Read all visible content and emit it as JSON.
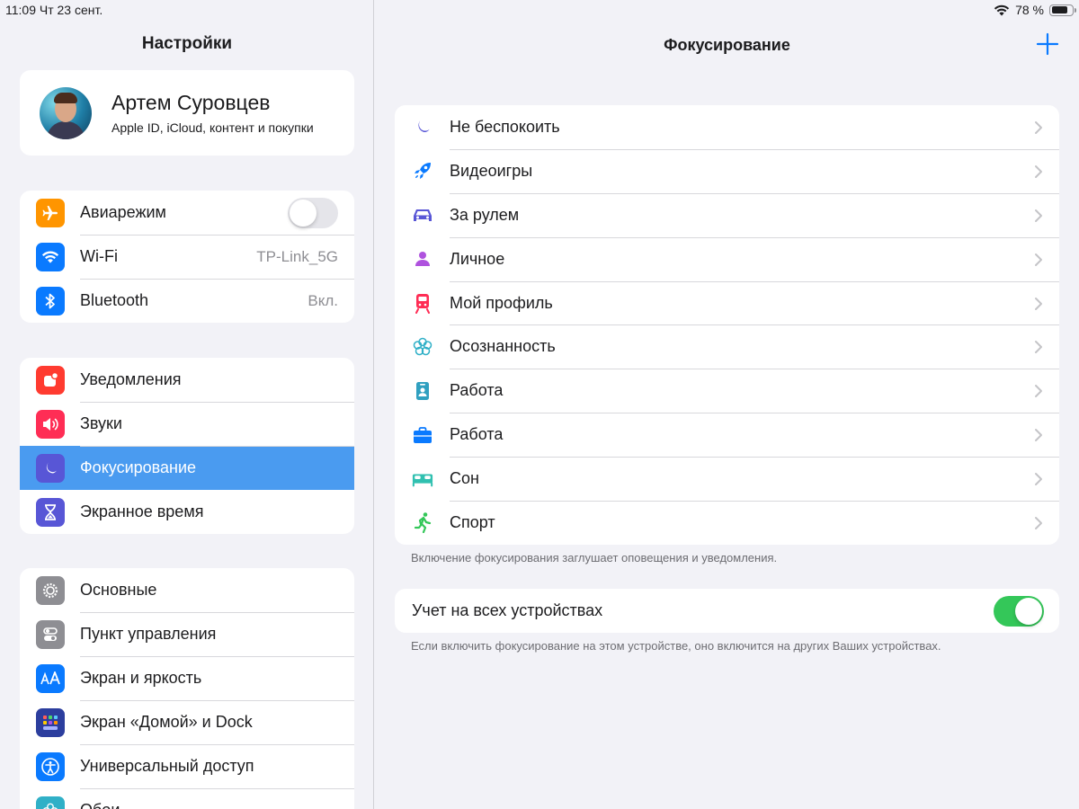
{
  "status": {
    "time": "11:09",
    "date": "Чт 23 сент.",
    "battery": "78 %",
    "battery_level": 0.78
  },
  "sidebar": {
    "title": "Настройки",
    "profile": {
      "name": "Артем Суровцев",
      "subtitle": "Apple ID, iCloud, контент и покупки"
    },
    "group1": [
      {
        "label": "Авиарежим",
        "icon": "airplane-icon",
        "color": "#ff9500",
        "toggle": false
      },
      {
        "label": "Wi-Fi",
        "icon": "wifi-icon",
        "color": "#0a7aff",
        "value": "TP-Link_5G"
      },
      {
        "label": "Bluetooth",
        "icon": "bluetooth-icon",
        "color": "#0a7aff",
        "value": "Вкл."
      }
    ],
    "group2": [
      {
        "label": "Уведомления",
        "icon": "notifications-icon",
        "color": "#ff3b30"
      },
      {
        "label": "Звуки",
        "icon": "speaker-icon",
        "color": "#ff2d55"
      },
      {
        "label": "Фокусирование",
        "icon": "moon-icon",
        "color": "#5856d6",
        "selected": true
      },
      {
        "label": "Экранное время",
        "icon": "hourglass-icon",
        "color": "#5856d6"
      }
    ],
    "group3": [
      {
        "label": "Основные",
        "icon": "gear-icon",
        "color": "#8e8e93"
      },
      {
        "label": "Пункт управления",
        "icon": "switches-icon",
        "color": "#8e8e93"
      },
      {
        "label": "Экран и яркость",
        "icon": "text-size-icon",
        "color": "#0a7aff"
      },
      {
        "label": "Экран «Домой» и Dock",
        "icon": "home-grid-icon",
        "color": "#2c3e9e"
      },
      {
        "label": "Универсальный доступ",
        "icon": "accessibility-icon",
        "color": "#0a7aff"
      },
      {
        "label": "Обои",
        "icon": "flower-icon",
        "color": "#30b0c7"
      }
    ]
  },
  "detail": {
    "title": "Фокусирование",
    "add_label": "+",
    "items": [
      {
        "label": "Не беспокоить",
        "icon": "moon-icon",
        "color": "#5856d6"
      },
      {
        "label": "Видеоигры",
        "icon": "rocket-icon",
        "color": "#0a7aff"
      },
      {
        "label": "За рулем",
        "icon": "car-icon",
        "color": "#5856d6"
      },
      {
        "label": "Личное",
        "icon": "person-icon",
        "color": "#af52de"
      },
      {
        "label": "Мой профиль",
        "icon": "train-icon",
        "color": "#ff2d55"
      },
      {
        "label": "Осознанность",
        "icon": "mindfulness-icon",
        "color": "#30b0c7"
      },
      {
        "label": "Работа",
        "icon": "id-badge-icon",
        "color": "#30a0c0"
      },
      {
        "label": "Работа",
        "icon": "briefcase-icon",
        "color": "#0a7aff"
      },
      {
        "label": "Сон",
        "icon": "bed-icon",
        "color": "#30c0b0"
      },
      {
        "label": "Спорт",
        "icon": "runner-icon",
        "color": "#34c759"
      }
    ],
    "focus_footnote": "Включение фокусирования заглушает оповещения и уведомления.",
    "sync_label": "Учет на всех устройствах",
    "sync_toggle": true,
    "sync_footnote": "Если включить фокусирование на этом устройстве, оно включится на других Ваших устройствах."
  }
}
